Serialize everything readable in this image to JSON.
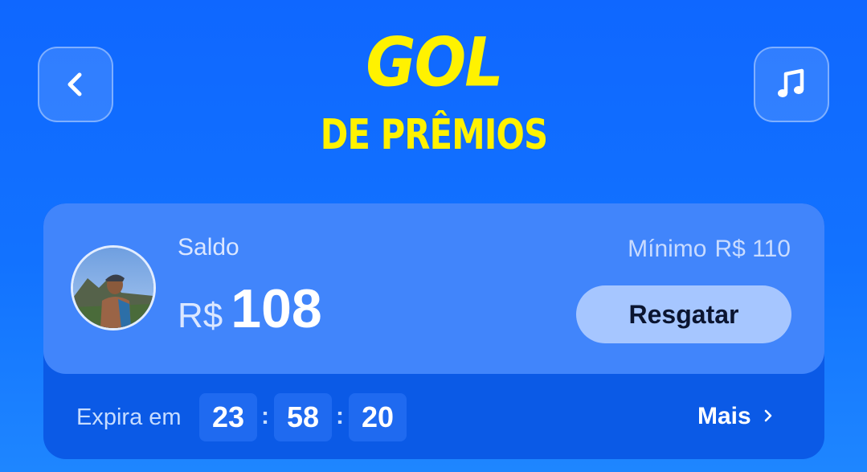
{
  "header": {
    "back_icon": "chevron-left-icon",
    "music_icon": "music-note-icon",
    "logo": {
      "line1": "GOL",
      "line2": "DE PRÊMIOS",
      "color": "#fff200"
    }
  },
  "card": {
    "avatar_icon": "user-photo-avatar",
    "saldo_label": "Saldo",
    "currency": "R$",
    "balance": "108",
    "minimum_label": "Mínimo",
    "minimum_value": "R$ 110",
    "redeem_label": "Resgatar",
    "expire": {
      "label": "Expira em",
      "hours": "23",
      "minutes": "58",
      "seconds": "20",
      "separator": ":"
    },
    "more_label": "Mais",
    "more_icon": "chevron-right-icon"
  },
  "colors": {
    "background": "#1272ff",
    "card_top": "#4185fb",
    "card_bottom": "#0b5ae6",
    "button": "#a6c6ff"
  }
}
